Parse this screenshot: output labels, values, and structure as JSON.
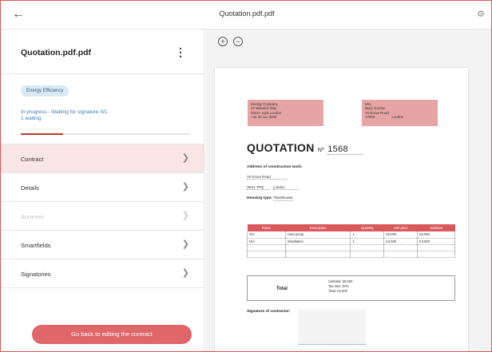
{
  "topbar": {
    "title": "Quotation.pdf.pdf"
  },
  "sidebar": {
    "title": "Quotation.pdf.pdf",
    "badge": "Energy Efficiency",
    "status_line1": "In progress - Waiting for signature 0/1",
    "status_line2": "1 waiting",
    "progress_percent": 25,
    "items": [
      {
        "label": "Contract"
      },
      {
        "label": "Details"
      },
      {
        "label": "Annexes"
      },
      {
        "label": "Smartfields"
      },
      {
        "label": "Signatories"
      }
    ],
    "back_button": "Go back to editing the contract"
  },
  "colors": {
    "accent": "#d9595b",
    "button": "#e06669",
    "active_bg": "#f9e5e5",
    "badge_bg": "#dbe9f5",
    "status_text": "#3d78b8"
  },
  "document": {
    "sender": [
      "Energy Company",
      "47 Warwick Way",
      "SW1V 1QS London",
      "+44 20 xxx 0252"
    ],
    "recipient": [
      "Mrs.",
      "Mary Gordon",
      "76 Grove Road",
      "77000",
      "London"
    ],
    "title": "QUOTATION",
    "number_label": "Nº",
    "number": "1568",
    "address_label": "Address of construction work:",
    "address_street": "76 Grove Road",
    "address_postcode": "SE31 7RQ",
    "address_city": "London",
    "housing_label": "Housing type:",
    "housing_value": "Townhouse",
    "table_headers": [
      "Room",
      "Description",
      "Quantity",
      "Unit price",
      "Subtotal"
    ],
    "table_rows": [
      [
        "N/A",
        "Heat pump",
        "1",
        "£6,000",
        "£6,000"
      ],
      [
        "N/A",
        "Installation",
        "1",
        "£3,000",
        "£3,000"
      ],
      [
        "",
        "",
        "",
        "",
        ""
      ],
      [
        "",
        "",
        "",
        "",
        ""
      ]
    ],
    "total_label": "Total",
    "subtotal": "Subtotal: £9,000",
    "tax": "Tax rate: 20%",
    "total": "Total: £9,000",
    "signature_label": "Signature of contractor:"
  }
}
